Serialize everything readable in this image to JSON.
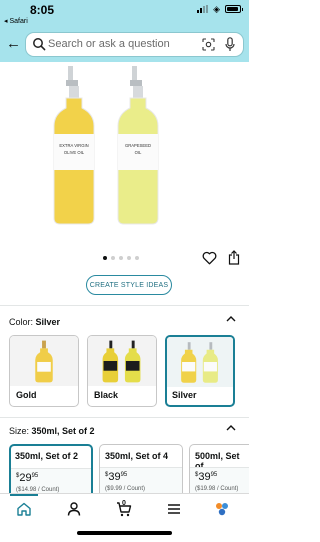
{
  "status_bar": {
    "time": "8:05",
    "back_app": "◂ Safari"
  },
  "search": {
    "placeholder": "Search or ask a question"
  },
  "product": {
    "image_count": 5,
    "active_image_index": 0,
    "bottle_labels": [
      {
        "line1": "EXTRA VIRGIN",
        "line2": "OLIVE OIL"
      },
      {
        "line1": "GRAPESEED",
        "line2": "OIL"
      }
    ]
  },
  "actions": {
    "create_style_ideas": "CREATE STYLE IDEAS"
  },
  "color": {
    "label": "Color:",
    "selected": "Silver",
    "options": [
      {
        "name": "Gold"
      },
      {
        "name": "Black"
      },
      {
        "name": "Silver",
        "selected": true
      }
    ]
  },
  "size": {
    "label": "Size:",
    "selected": "350ml, Set of 2",
    "options": [
      {
        "name": "350ml, Set of 2",
        "currency": "$",
        "whole": "29",
        "fraction": "95",
        "unit": "($14.98 / Count)",
        "selected": true
      },
      {
        "name": "350ml, Set of 4",
        "currency": "$",
        "whole": "39",
        "fraction": "95",
        "unit": "($9.99 / Count)"
      },
      {
        "name": "500ml, Set of",
        "currency": "$",
        "whole": "39",
        "fraction": "95",
        "unit": "($19.98 / Count)"
      }
    ]
  },
  "bottom_nav": {
    "cart_count": "0"
  },
  "colors": {
    "header_bg": "#a6e3ec",
    "accent": "#1a7f95"
  }
}
